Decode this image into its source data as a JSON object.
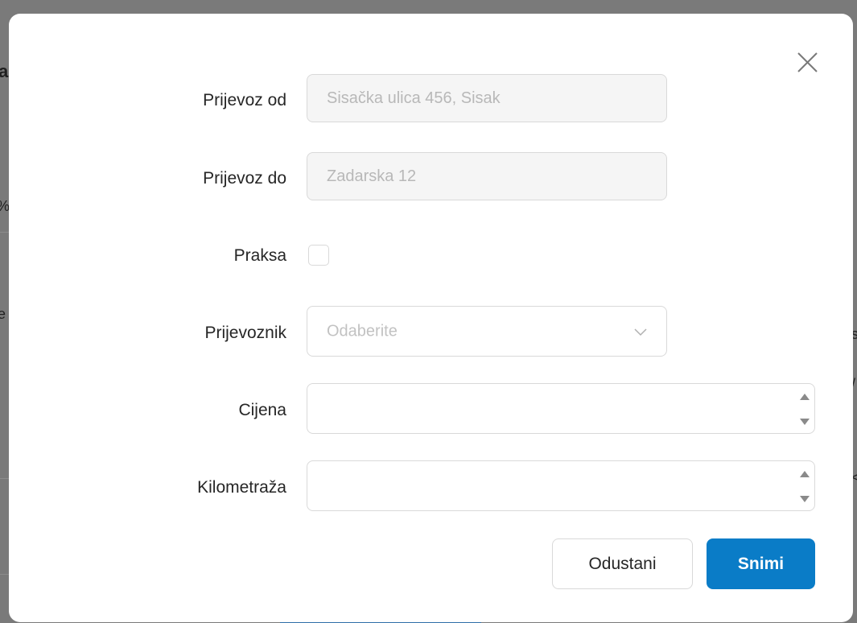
{
  "background": {
    "fragments": [
      "a",
      "%",
      "e",
      "s",
      "/",
      "<"
    ]
  },
  "modal": {
    "close_icon": "close-icon",
    "fields": {
      "transport_from": {
        "label": "Prijevoz od",
        "placeholder": "Sisačka ulica 456, Sisak"
      },
      "transport_to": {
        "label": "Prijevoz do",
        "placeholder": "Zadarska 12"
      },
      "practice": {
        "label": "Praksa",
        "checked": false
      },
      "carrier": {
        "label": "Prijevoznik",
        "placeholder": "Odaberite"
      },
      "price": {
        "label": "Cijena",
        "value": ""
      },
      "mileage": {
        "label": "Kilometraža",
        "value": ""
      }
    },
    "buttons": {
      "cancel_label": "Odustani",
      "save_label": "Snimi"
    },
    "colors": {
      "primary": "#0a7cc7",
      "overlay": "#7a7a7a"
    }
  }
}
